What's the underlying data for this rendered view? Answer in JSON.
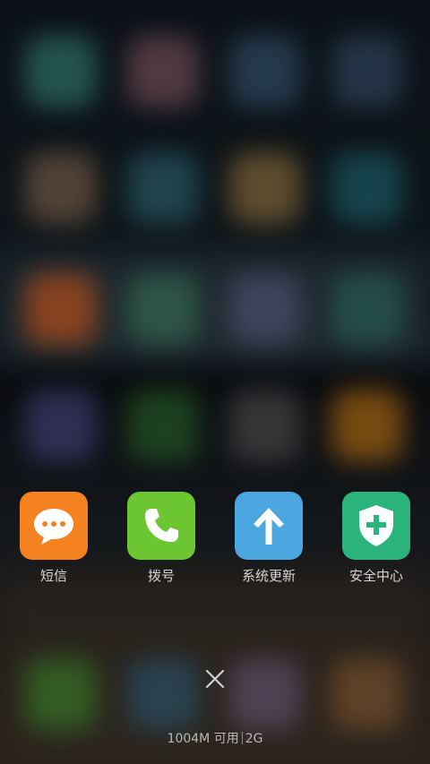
{
  "recent_apps": [
    {
      "label": "短信",
      "icon": "message-bubble-icon",
      "color": "#f58220"
    },
    {
      "label": "拨号",
      "icon": "phone-icon",
      "color": "#6cc631"
    },
    {
      "label": "系统更新",
      "icon": "arrow-up-icon",
      "color": "#4ca6e0"
    },
    {
      "label": "安全中心",
      "icon": "shield-plus-icon",
      "color": "#2bb37c"
    }
  ],
  "memory": {
    "available": "1004M 可用",
    "total": "2G"
  },
  "close": {
    "icon": "close-icon"
  }
}
